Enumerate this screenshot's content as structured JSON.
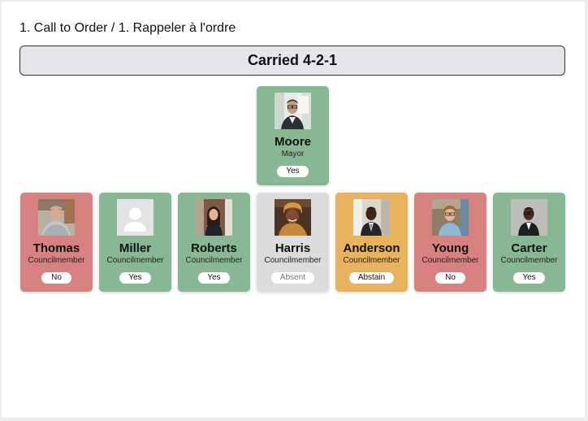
{
  "agenda": {
    "title": "1. Call to Order / 1. Rappeler à l'ordre"
  },
  "result": {
    "label": "Carried 4-2-1"
  },
  "colors": {
    "yes": "#88b794",
    "no": "#d88181",
    "absent": "#dcdcdc",
    "abstain": "#e9b25c"
  },
  "mayor": {
    "name": "Moore",
    "role": "Mayor",
    "vote": "Yes",
    "status": "yes",
    "photo": "person-photo"
  },
  "council": [
    {
      "name": "Thomas",
      "role": "Councilmember",
      "vote": "No",
      "status": "no",
      "photo": "person-photo"
    },
    {
      "name": "Miller",
      "role": "Councilmember",
      "vote": "Yes",
      "status": "yes",
      "photo": "default-avatar-icon"
    },
    {
      "name": "Roberts",
      "role": "Councilmember",
      "vote": "Yes",
      "status": "yes",
      "photo": "person-photo"
    },
    {
      "name": "Harris",
      "role": "Councilmember",
      "vote": "Absent",
      "status": "absent",
      "photo": "person-photo"
    },
    {
      "name": "Anderson",
      "role": "Councilmember",
      "vote": "Abstain",
      "status": "abstain",
      "photo": "person-photo"
    },
    {
      "name": "Young",
      "role": "Councilmember",
      "vote": "No",
      "status": "no",
      "photo": "person-photo"
    },
    {
      "name": "Carter",
      "role": "Councilmember",
      "vote": "Yes",
      "status": "yes",
      "photo": "person-photo"
    }
  ]
}
